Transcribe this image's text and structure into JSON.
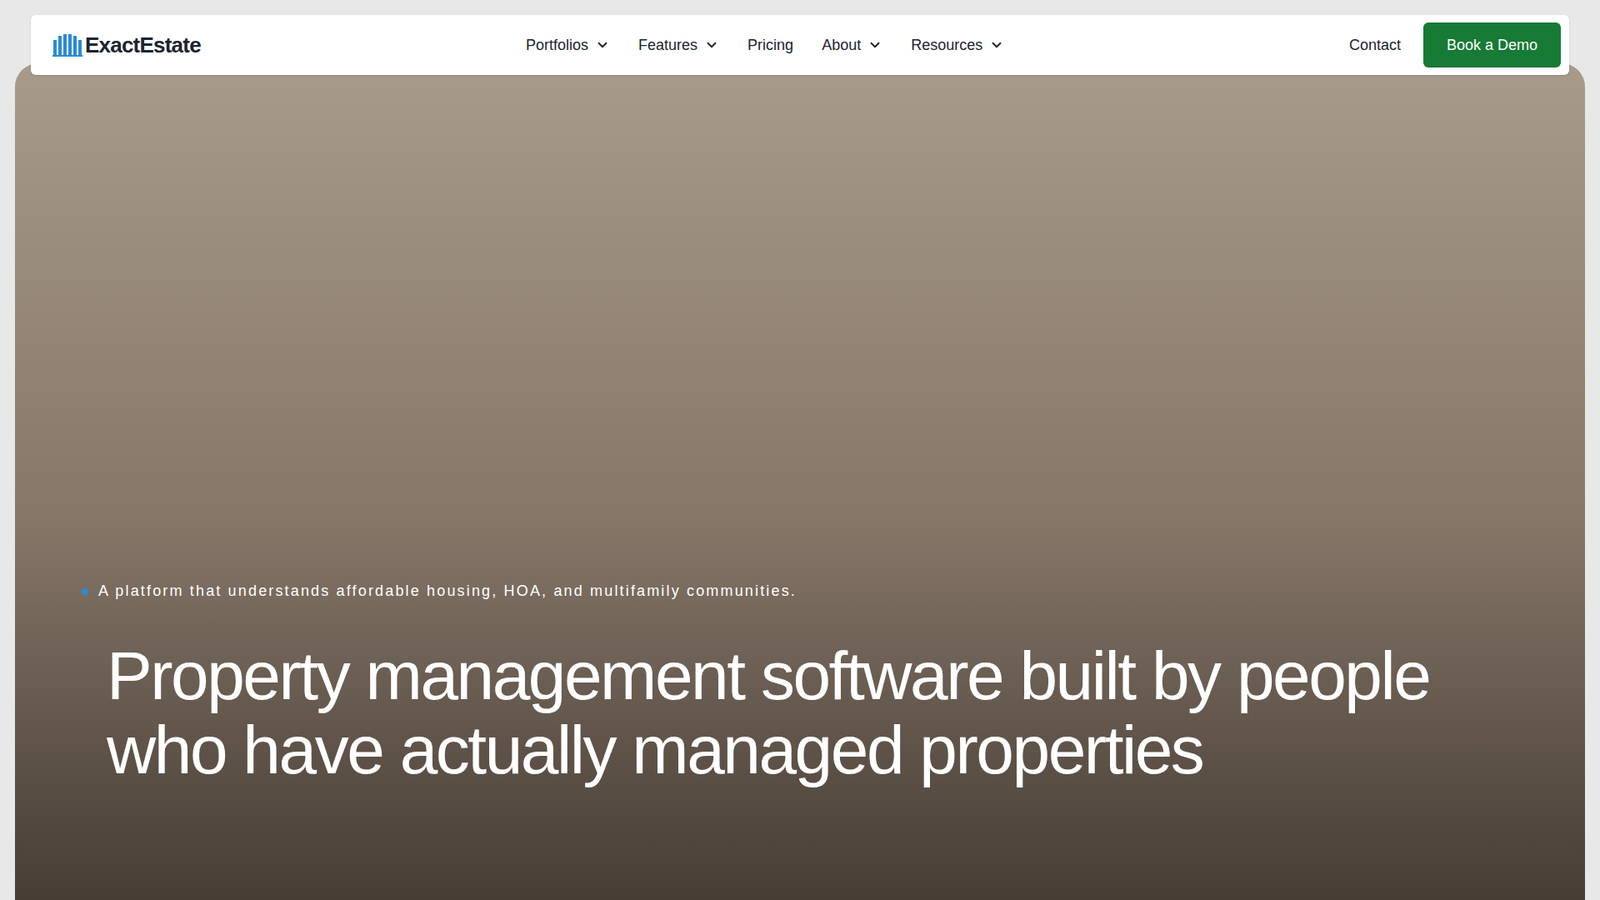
{
  "logo": {
    "text": "ExactEstate"
  },
  "nav": {
    "items": [
      {
        "label": "Portfolios",
        "dropdown": true
      },
      {
        "label": "Features",
        "dropdown": true
      },
      {
        "label": "Pricing",
        "dropdown": false
      },
      {
        "label": "About",
        "dropdown": true
      },
      {
        "label": "Resources",
        "dropdown": true
      }
    ],
    "contact": "Contact",
    "cta": "Book a Demo"
  },
  "hero": {
    "tagline": "A platform that understands affordable housing, HOA, and multifamily communities.",
    "headline": "Property management software built by people who have actually managed properties"
  }
}
